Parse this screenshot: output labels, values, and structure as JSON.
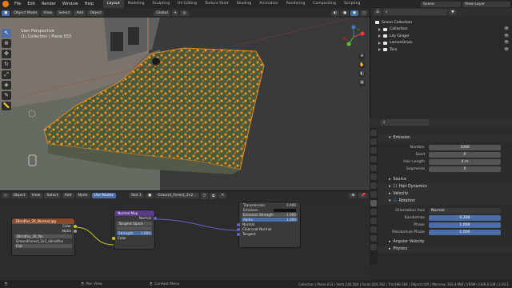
{
  "topbar": {
    "menus": [
      "File",
      "Edit",
      "Render",
      "Window",
      "Help"
    ],
    "workspaces": [
      "Layout",
      "Modeling",
      "Sculpting",
      "UV Editing",
      "Texture Paint",
      "Shading",
      "Animation",
      "Rendering",
      "Compositing",
      "Scripting"
    ],
    "active_workspace": "Layout",
    "scene_label": "Scene",
    "view_layer_label": "View Layer"
  },
  "viewport_header": {
    "mode": "Object Mode",
    "menus": [
      "View",
      "Select",
      "Add",
      "Object"
    ],
    "orientation": "Global"
  },
  "viewport": {
    "perspective": "User Perspective",
    "collection_line": "(1) Collection | Plane.033"
  },
  "outliner": {
    "title": "Scene Collection",
    "items": [
      {
        "label": "Collection"
      },
      {
        "label": "Lily Ginger"
      },
      {
        "label": "LemonGrass"
      },
      {
        "label": "Taro"
      }
    ]
  },
  "properties": {
    "emission_section": "Emission",
    "rows_emission": [
      {
        "label": "Number",
        "value": "1000"
      },
      {
        "label": "Seed",
        "value": "0"
      },
      {
        "label": "Hair Length",
        "value": "4 m"
      },
      {
        "label": "Segments",
        "value": "5"
      }
    ],
    "source": "Source",
    "hair_dynamics": "Hair Dynamics",
    "velocity": "Velocity",
    "rotation": "Rotation",
    "rows_rotation": [
      {
        "label": "Orientation Axis",
        "value": "Normal",
        "style": "dark"
      },
      {
        "label": "Randomize",
        "value": "0.206",
        "style": "blue"
      },
      {
        "label": "Phase",
        "value": "1.000",
        "style": "blue"
      },
      {
        "label": "Randomize Phase",
        "value": "1.000",
        "style": "blue"
      }
    ],
    "angular_velocity": "Angular Velocity",
    "physics": "Physics"
  },
  "node_header": {
    "type": "Object",
    "menus": [
      "View",
      "Select",
      "Add",
      "Node"
    ],
    "use_nodes": "Use Nodes",
    "slot": "Slot 1",
    "material": "Ground_Forest_2x2..."
  },
  "nodes": {
    "image_tex": {
      "title": "3Brsdfus_2K_Normal.jpg",
      "out_color": "Color",
      "out_alpha": "Alpha",
      "image_name": "3Brsdfus_2K_No",
      "field": "Flat",
      "label": "GroundForest_2x2_s8nsdfus"
    },
    "normal_map": {
      "title": "Normal Map",
      "out_normal": "Normal",
      "space": "Tangent Space",
      "uv": "",
      "strength_label": "Strength",
      "strength_value": "1.000",
      "in_color": "Color"
    },
    "bsdf": {
      "rows": [
        {
          "label": "Transmission",
          "value": "0.000"
        },
        {
          "label": "Emission",
          "value": ""
        },
        {
          "label": "Emission Strength",
          "value": "1.000"
        },
        {
          "label": "Alpha",
          "value": "1.000"
        },
        {
          "label": "Normal",
          "value": ""
        },
        {
          "label": "Clearcoat Normal",
          "value": ""
        },
        {
          "label": "Tangent",
          "value": ""
        }
      ]
    }
  },
  "statusbar": {
    "pan_view": "Pan View",
    "context_menu": "Context Menu",
    "stats": "Collection | Plane.033 | Verts:244,584 | Faces:244,782 | Tris:489,564 | Objects:0/5 | Memory: 302.4 MiB | VRAM: 0.6/8.0 GiB | 2.93.1"
  },
  "colors": {
    "accent": "#4a6ea8",
    "selection_orange": "#e8891a",
    "blender_orange": "#e87d0d"
  }
}
